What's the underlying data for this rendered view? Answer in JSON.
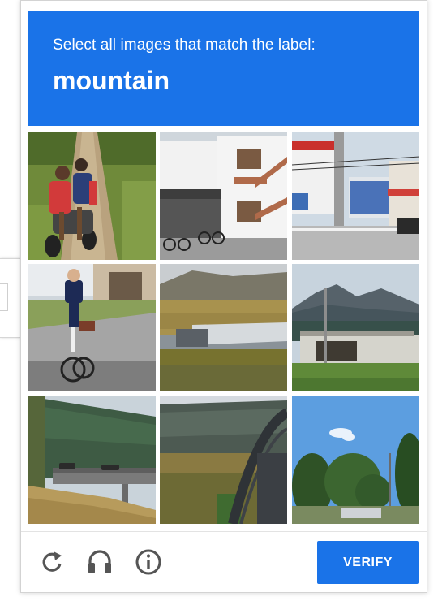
{
  "challenge": {
    "prompt": "Select all images that match the label:",
    "label": "mountain"
  },
  "tiles": [
    {
      "name": "tile-1",
      "depicts": "two people on motorbike on dirt path"
    },
    {
      "name": "tile-2",
      "depicts": "houses with parked bicycles"
    },
    {
      "name": "tile-3",
      "depicts": "street with pole and signs"
    },
    {
      "name": "tile-4",
      "depicts": "woman riding bicycle"
    },
    {
      "name": "tile-5",
      "depicts": "field with hills and structure"
    },
    {
      "name": "tile-6",
      "depicts": "mountain range over building"
    },
    {
      "name": "tile-7",
      "depicts": "forested mountain with bridge"
    },
    {
      "name": "tile-8",
      "depicts": "arch bridge in valley"
    },
    {
      "name": "tile-9",
      "depicts": "trees under blue sky"
    }
  ],
  "footer": {
    "reload_icon": "reload-icon",
    "audio_icon": "headphones-icon",
    "info_icon": "info-icon",
    "verify_label": "VERIFY"
  },
  "colors": {
    "accent": "#1a73e8",
    "icon": "#555555"
  }
}
